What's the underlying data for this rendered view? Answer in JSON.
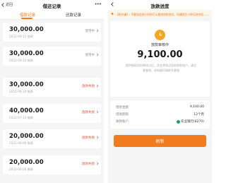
{
  "left": {
    "nav": {
      "back_label": "返回",
      "title": "借还记录",
      "more_icon": "more-icon"
    },
    "tabs": [
      {
        "label": "借款记录",
        "active": true
      },
      {
        "label": "还款记录",
        "active": false
      }
    ],
    "records": [
      {
        "amount": "30,000.00",
        "date": "2022-09-12  借款",
        "status": "使用中",
        "failed": false
      },
      {
        "amount": "30,000.00",
        "date": "2022-09-12  借款",
        "status": "使用中",
        "failed": false
      },
      {
        "amount": "30,000.00",
        "date": "2022-09-10  借款",
        "status": "放款失败",
        "failed": true
      },
      {
        "amount": "40,000.00",
        "date": "2022-07-14  借款",
        "status": "放款失败",
        "failed": true
      },
      {
        "amount": "20,000.00",
        "date": "2022-06-09  借款",
        "status": "放款失败",
        "failed": true
      },
      {
        "amount": "20,000.00",
        "date": "2022-06-06  借款",
        "status": "放款失败",
        "failed": true
      }
    ]
  },
  "right": {
    "nav": {
      "title": "放款进度"
    },
    "notice": "【防诈骗】: 不要轻信他人所称可以更改贷款合同，如遇陌生人称可改合同……",
    "status": {
      "title": "放款审核中",
      "amount": "9,100.00",
      "desc": "提供借款资料审核过后，资金将到达您的收款账户，请注意查收，如有疑问请联系客服"
    },
    "details": [
      {
        "label": "借款金额",
        "value": "9,100.00"
      },
      {
        "label": "借款期限",
        "value": "12个月"
      },
      {
        "label": "收款账户",
        "value": "农业银行(8270)",
        "bank_icon": "bank-icon"
      }
    ],
    "refresh_label": "刷新"
  },
  "colors": {
    "accent": "#f07c1f",
    "fail": "#e8503a",
    "bank_green": "#19a15f",
    "status_icon": "#f5a623"
  }
}
